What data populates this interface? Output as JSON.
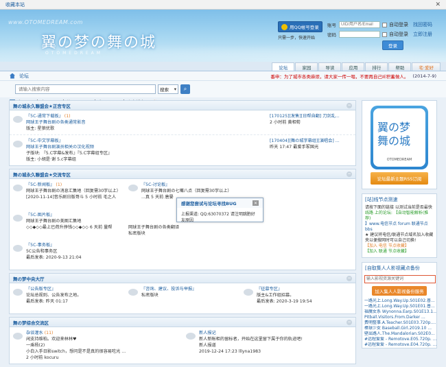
{
  "topbar": {
    "label": "收藏本站",
    "close": "✕"
  },
  "header": {
    "logo_url": "www.OTOMEDREAM.com",
    "logo_text": "翼の梦の舞の城",
    "logo_en": "OTOMEDREAM",
    "qq_button": "用QQ帐号登录",
    "qq_sub": "只需一步，快速开始",
    "account_label": "账号",
    "account_value": "UID/用户名/Email",
    "password_label": "密码",
    "auto_login": "自动登录",
    "find_password": "找回密码",
    "login_button": "登录",
    "register": "立即注册"
  },
  "nav": {
    "tabs": [
      "论坛",
      "家园",
      "导读",
      "应用",
      "排行",
      "帮助",
      "宅·爱好"
    ]
  },
  "crumb": {
    "label": "论坛",
    "notice": "番申：为了城市各类麻烦，请大家一传一唱，不要再自己IE积蓄做人。",
    "date": "(2014-7-9)"
  },
  "search": {
    "placeholder": "请输入搜索内容",
    "type": "搜索",
    "button": "⌕"
  },
  "stats": {
    "today": "今日: 56",
    "yesterday": "昨日: 159",
    "posts": "帖子: 49405",
    "members": "会员: 4946",
    "welcome": "欢迎新会员:",
    "newest": "当退"
  },
  "sections": [
    {
      "title": "舞の城永久聯盟会★正宫专区",
      "rows": [
        {
          "title": "『5C-通常下载板』",
          "new": "(1)",
          "desc": "网球王子舞台剧の各类通常影音",
          "mod": "版主: 星狼优歌",
          "last1": "[170125][发售][日帮自翻] 刀剑乱...",
          "last2": "2 小时前 黄相荀"
        },
        {
          "title": "『5C-中文字幕板』",
          "new": "",
          "desc": "网球王子舞台剧演员相关の汉化视频",
          "mod": "子版块: 『5.C字幕&发布』『5.C字幕组专区』",
          "mod2": "版主: 小胡是·谢 5.c字幕组",
          "last1": "[170404][舞の城字幕组][演唱会] ...",
          "last2": "昨天 17:47 最爱手冢国光"
        }
      ]
    },
    {
      "title": "舞の城永久聯盟会★交流专区",
      "cells": [
        {
          "title": "『5C-新闻板』",
          "new": "(1)",
          "desc": "网球王子舞台剧の消息汇集地（回复需30字以上）",
          "last": "[2020-11-14]音乐剧日版哥斗 5 小时前 毛之人"
        },
        {
          "title": "『5C-讨论板』",
          "new": "",
          "desc": "网球王子舞台剧の七嘴八点（回复需30字以上）",
          "last": "...真 5 天前 唐晏"
        },
        {
          "title": "",
          "new": "",
          "desc": "",
          "last": ""
        },
        {
          "title": "『5C-图片板』",
          "new": "",
          "desc": "网球王子舞台剧の美图汇集地",
          "last": "◇◇◆◇◇最上已荷升挣钱◇◇◆◇◇ 6 天前 量帮"
        },
        {
          "title": "",
          "new": "",
          "desc": "网球王子舞台剧の各类翻译",
          "last": "私密版块"
        },
        {
          "title": "",
          "new": "",
          "desc": "",
          "last": ""
        },
        {
          "title": "『5C-事务板』",
          "new": "",
          "desc": "5C公告和事务区",
          "last": "最后发表: 2020-9-13 21:04"
        }
      ]
    },
    {
      "title": "舞の梦中央大厅",
      "cells": [
        {
          "title": "『公告版专区』",
          "desc": "论坛总规则、公告发布之地。",
          "last": "最后发表: 昨天 01:17"
        },
        {
          "title": "『咨询、建议、投诉与举报』",
          "desc": "",
          "last": "私密版块"
        },
        {
          "title": "『征募专区』",
          "desc": "版主&工作组招募。",
          "last": "最后发表: 2020-3-19 19:54"
        }
      ]
    },
    {
      "title": "舞の梦综合交流区",
      "cells2": [
        {
          "title": "杂谈灌水",
          "new": "(11)",
          "desc": "闲支持维柏。欢迎来林林♥",
          "desc2": "一乘杨(2)",
          "last": "小白入手日影switch，想问是不是真的很容易吃光 ...",
          "last2": "2 小时前 kocuru"
        },
        {
          "title": "新人报记",
          "new": "",
          "desc": "新人新帐柜的留标者，开始在这里留下属于你的轨迹吧!",
          "desc2": "新人报道",
          "last": "2019-12-24 17:23 lllyna1983",
          "last2": ""
        }
      ]
    }
  ],
  "popup": {
    "title": "感谢您尝试与论坛寻找BUG",
    "body": "上报渠道: QQ:63070372 请注明跳胞好友原因",
    "close": "✕"
  },
  "side": {
    "logo_text": "翼の梦\n舞の城",
    "logo_sub": "OTOMEDREAM",
    "rss": "论坛最新主题RSS订阅",
    "tips_title": "[站]线节点测速",
    "tips_1": "请按下面的链接 以测试当前是否最快",
    "tips_2": "线路 上的论坛: 【自动智能解析(推荐)",
    "tips_3": "】www.电信节点 forum 联通节点",
    "tips_4": "bbs",
    "tips_5": "★ 建议将电信/联通节点域名加入收藏夹以便搜网时可以自己切换!",
    "tips_6": "【加入 电信 节点收藏】",
    "tips_7": "【加入 联通 节点收藏】",
    "search_title": "[自取集人人影视藏点备份",
    "search_placeholder": "输入影视资源关键词",
    "search_button": "加入集人人影视备份服务",
    "list": [
      "一路光上.Long.Way.Up.S01E02.普...",
      "一路光上.Long.Way.Up.S01E01.普...",
      "福魔女系 Wynonna.Earp.S01E13.1...",
      "Pitball.Visitors.From.Darker ...",
      "费明整事.A.Teacher.S01E03.720p....",
      "棒球少女 Baseball.Girl.2019.10 ...",
      "壁出路人.The.Mandalorian.S02E0...",
      "#远程爱爱 - Remotove.E05.720p. ...",
      "#远程爱爱 - Remotove.E04.720p. ..."
    ]
  },
  "colors": {
    "accent": "#1a5c9e",
    "orange": "#e07f2a",
    "red": "#cc0000"
  }
}
